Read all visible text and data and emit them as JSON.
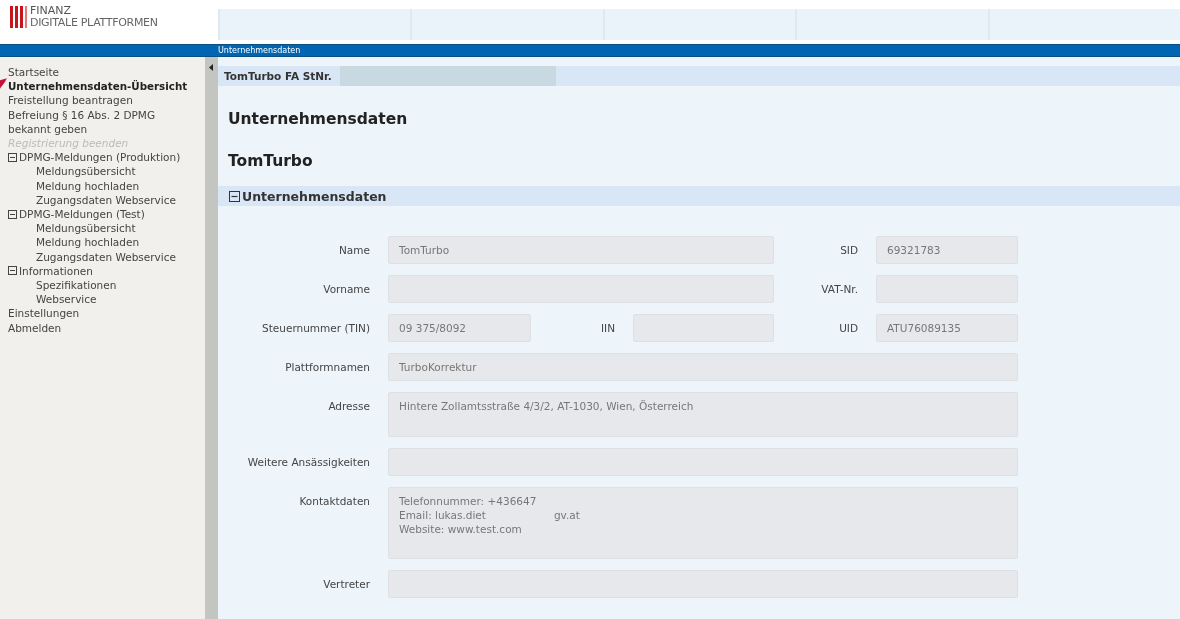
{
  "logo": {
    "line_1": "FINANZ",
    "line_2": "DIGITALE PLATTFORMEN"
  },
  "breadcrumb": "Unternehmensdaten",
  "sidebar": {
    "items": [
      {
        "label": "Startseite",
        "kind": "link",
        "selected": false,
        "disabled": false
      },
      {
        "label": "Unternehmensdaten-Übersicht",
        "kind": "link",
        "selected": true,
        "disabled": false
      },
      {
        "label": "Freistellung beantragen",
        "kind": "link",
        "selected": false,
        "disabled": false
      },
      {
        "label": "Befreiung § 16 Abs. 2 DPMG bekannt geben",
        "kind": "link",
        "selected": false,
        "disabled": false
      },
      {
        "label": "Registrierung beenden",
        "kind": "link",
        "selected": false,
        "disabled": true
      },
      {
        "label": "DPMG-Meldungen (Produktion)",
        "kind": "group",
        "selected": false,
        "disabled": false,
        "expanded": true,
        "children": [
          {
            "label": "Meldungsübersicht",
            "selected": false
          },
          {
            "label": "Meldung hochladen",
            "selected": false
          },
          {
            "label": "Zugangsdaten Webservice",
            "selected": false
          }
        ]
      },
      {
        "label": "DPMG-Meldungen (Test)",
        "kind": "group",
        "selected": false,
        "disabled": false,
        "expanded": true,
        "children": [
          {
            "label": "Meldungsübersicht",
            "selected": false
          },
          {
            "label": "Meldung hochladen",
            "selected": false
          },
          {
            "label": "Zugangsdaten Webservice",
            "selected": false
          }
        ]
      },
      {
        "label": "Informationen",
        "kind": "group",
        "selected": false,
        "disabled": false,
        "expanded": true,
        "children": [
          {
            "label": "Spezifikationen",
            "selected": false
          },
          {
            "label": "Webservice",
            "selected": false
          }
        ]
      },
      {
        "label": "Einstellungen",
        "kind": "link",
        "selected": false,
        "disabled": false
      },
      {
        "label": "Abmelden",
        "kind": "link",
        "selected": false,
        "disabled": false
      }
    ]
  },
  "tax_bar": {
    "label": "TomTurbo FA StNr."
  },
  "heading": "Unternehmensdaten",
  "company": "TomTurbo",
  "section": {
    "title": "Unternehmensdaten",
    "expanded": true,
    "rows": [
      [
        {
          "label": "Name",
          "kind": "input",
          "value": "TomTurbo"
        },
        {
          "label": "SID",
          "kind": "input",
          "value": "69321783"
        }
      ],
      [
        {
          "label": "Vorname",
          "kind": "input"
        },
        {
          "label": "VAT-Nr.",
          "kind": "input"
        }
      ],
      [
        {
          "label": "Steuernummer (TIN)",
          "kind": "input",
          "value": "09 375/8092"
        },
        {
          "label": "IIN",
          "kind": "input"
        },
        {
          "label": "UID",
          "kind": "input",
          "value": "ATU76089135"
        }
      ],
      [
        {
          "label": "Plattformnamen",
          "kind": "input",
          "value": "TurboKorrektur"
        }
      ],
      [
        {
          "label": "Adresse",
          "kind": "textarea",
          "lines": [
            [
              "Hintere Zollamtsstraße 4/3/2, AT-1030, Wien, Österreich"
            ]
          ]
        }
      ],
      [
        {
          "label": "Weitere Ansässigkeiten",
          "kind": "input"
        }
      ],
      [
        {
          "label": "Kontaktdaten",
          "kind": "textarea",
          "lines": [
            [
              "Telefonnummer: +436647"
            ],
            [
              "Email: lukas.diet",
              "gv.at"
            ],
            [
              "Website: www.test.com"
            ]
          ]
        }
      ],
      [
        {
          "label": "Vertreter",
          "kind": "input"
        }
      ]
    ]
  }
}
